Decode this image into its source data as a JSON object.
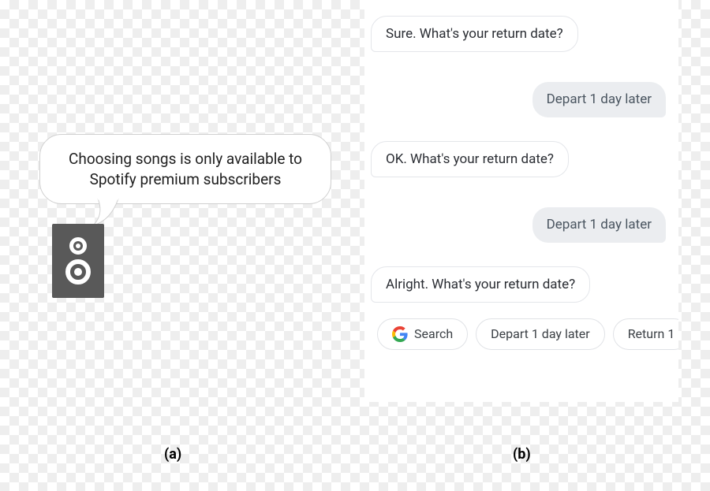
{
  "panel_a": {
    "bubble_line1": "Choosing songs is only available to",
    "bubble_line2": "Spotify premium subscribers",
    "caption": "(a)"
  },
  "panel_b": {
    "messages": [
      {
        "side": "left",
        "role": "bot",
        "text": "Sure. What's your return date?"
      },
      {
        "side": "right",
        "role": "user",
        "text": "Depart 1 day later"
      },
      {
        "side": "left",
        "role": "bot",
        "text": "OK. What's your return date?"
      },
      {
        "side": "right",
        "role": "user",
        "text": "Depart 1 day later"
      },
      {
        "side": "left",
        "role": "bot",
        "text": "Alright. What's your return date?"
      }
    ],
    "chips": {
      "search": "Search",
      "depart": "Depart 1 day later",
      "return_partial": "Return 1"
    },
    "caption": "(b)"
  }
}
